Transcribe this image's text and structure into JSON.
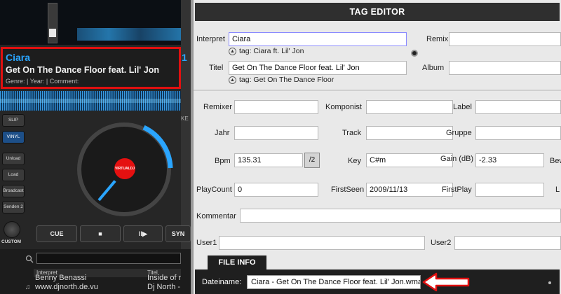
{
  "deck": {
    "artist": "Ciara",
    "title": "Get On The Dance Floor feat. Lil' Jon",
    "meta": "Genre:  | Year:  | Comment:",
    "side_number": "1",
    "side_label": "KE",
    "buttons": [
      "SLIP",
      "VINYL",
      "Unload",
      "Load",
      "Broadcast",
      "Senden 2"
    ],
    "custom_label": "CUSTOM",
    "platter_label": "VIRTUALDJ",
    "transport": {
      "cue": "CUE",
      "stop": "■",
      "play_pause": "II▶",
      "sync": "SYN"
    }
  },
  "browser": {
    "columns": [
      "Interpret",
      "Titel"
    ],
    "rows": [
      {
        "artist": "Benny Benassi",
        "title": "Inside of me"
      },
      {
        "artist": "www.djnorth.de.vu",
        "title": "Dj North - M"
      }
    ]
  },
  "tag_editor": {
    "header": "TAG EDITOR",
    "interpret": {
      "label": "Interpret",
      "value": "Ciara",
      "hint": "tag: Ciara ft. Lil' Jon"
    },
    "remix": {
      "label": "Remix",
      "value": ""
    },
    "titel": {
      "label": "Titel",
      "value": "Get On The Dance Floor feat. Lil' Jon",
      "hint": "tag: Get On The Dance Floor"
    },
    "album": {
      "label": "Album",
      "value": ""
    },
    "remixer": {
      "label": "Remixer",
      "value": ""
    },
    "komponist": {
      "label": "Komponist",
      "value": ""
    },
    "label_field": {
      "label": "Label",
      "value": ""
    },
    "jahr": {
      "label": "Jahr",
      "value": ""
    },
    "track": {
      "label": "Track",
      "value": ""
    },
    "gruppe": {
      "label": "Gruppe",
      "value": ""
    },
    "bpm": {
      "label": "Bpm",
      "value": "135.31",
      "half_button": "/2"
    },
    "key": {
      "label": "Key",
      "value": "C#m"
    },
    "gain": {
      "label": "Gain (dB)",
      "value": "-2.33"
    },
    "bew": {
      "label": "Bew",
      "value": ""
    },
    "playcount": {
      "label": "PlayCount",
      "value": "0"
    },
    "firstseen": {
      "label": "FirstSeen",
      "value": "2009/11/13"
    },
    "firstplay": {
      "label": "FirstPlay",
      "value": ""
    },
    "last_partial": {
      "label": "L",
      "value": ""
    },
    "kommentar": {
      "label": "Kommentar",
      "value": ""
    },
    "user1": {
      "label": "User1",
      "value": ""
    },
    "user2": {
      "label": "User2",
      "value": ""
    },
    "file_info": {
      "tab": "FILE INFO",
      "filename_label": "Dateiname:",
      "filename": "Ciara - Get On The Dance Floor feat. Lil' Jon.wma"
    }
  },
  "colors": {
    "highlight_border": "#e01010",
    "artist_blue": "#2aa5ff",
    "header_bg": "#2f2f2f"
  }
}
